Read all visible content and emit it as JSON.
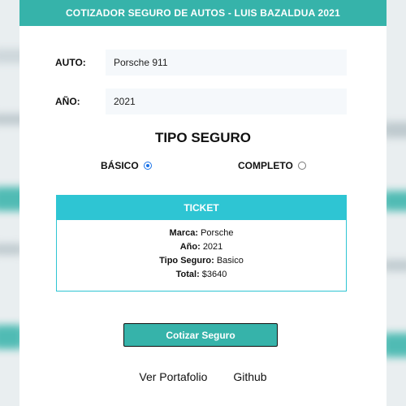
{
  "header": {
    "title": "COTIZADOR SEGURO DE AUTOS - LUIS BAZALDUA 2021"
  },
  "form": {
    "auto_label": "AUTO:",
    "auto_value": "Porsche 911",
    "anio_label": "AÑO:",
    "anio_value": "2021"
  },
  "tipo_seguro": {
    "title": "TIPO SEGURO",
    "options": [
      {
        "label": "BÁSICO",
        "checked": true
      },
      {
        "label": "COMPLETO",
        "checked": false
      }
    ]
  },
  "ticket": {
    "title": "TICKET",
    "marca_label": "Marca:",
    "marca_value": "Porsche",
    "anio_label": "Año:",
    "anio_value": "2021",
    "tipo_label": "Tipo Seguro:",
    "tipo_value": "Basico",
    "total_label": "Total:",
    "total_value": "$3640"
  },
  "actions": {
    "cotizar_label": "Cotizar Seguro"
  },
  "footer": {
    "portafolio_label": "Ver Portafolio",
    "github_label": "Github"
  },
  "colors": {
    "header": "#36b3aa",
    "ticket_accent": "#2ec5d3",
    "radio_checked": "#1a73e8"
  }
}
